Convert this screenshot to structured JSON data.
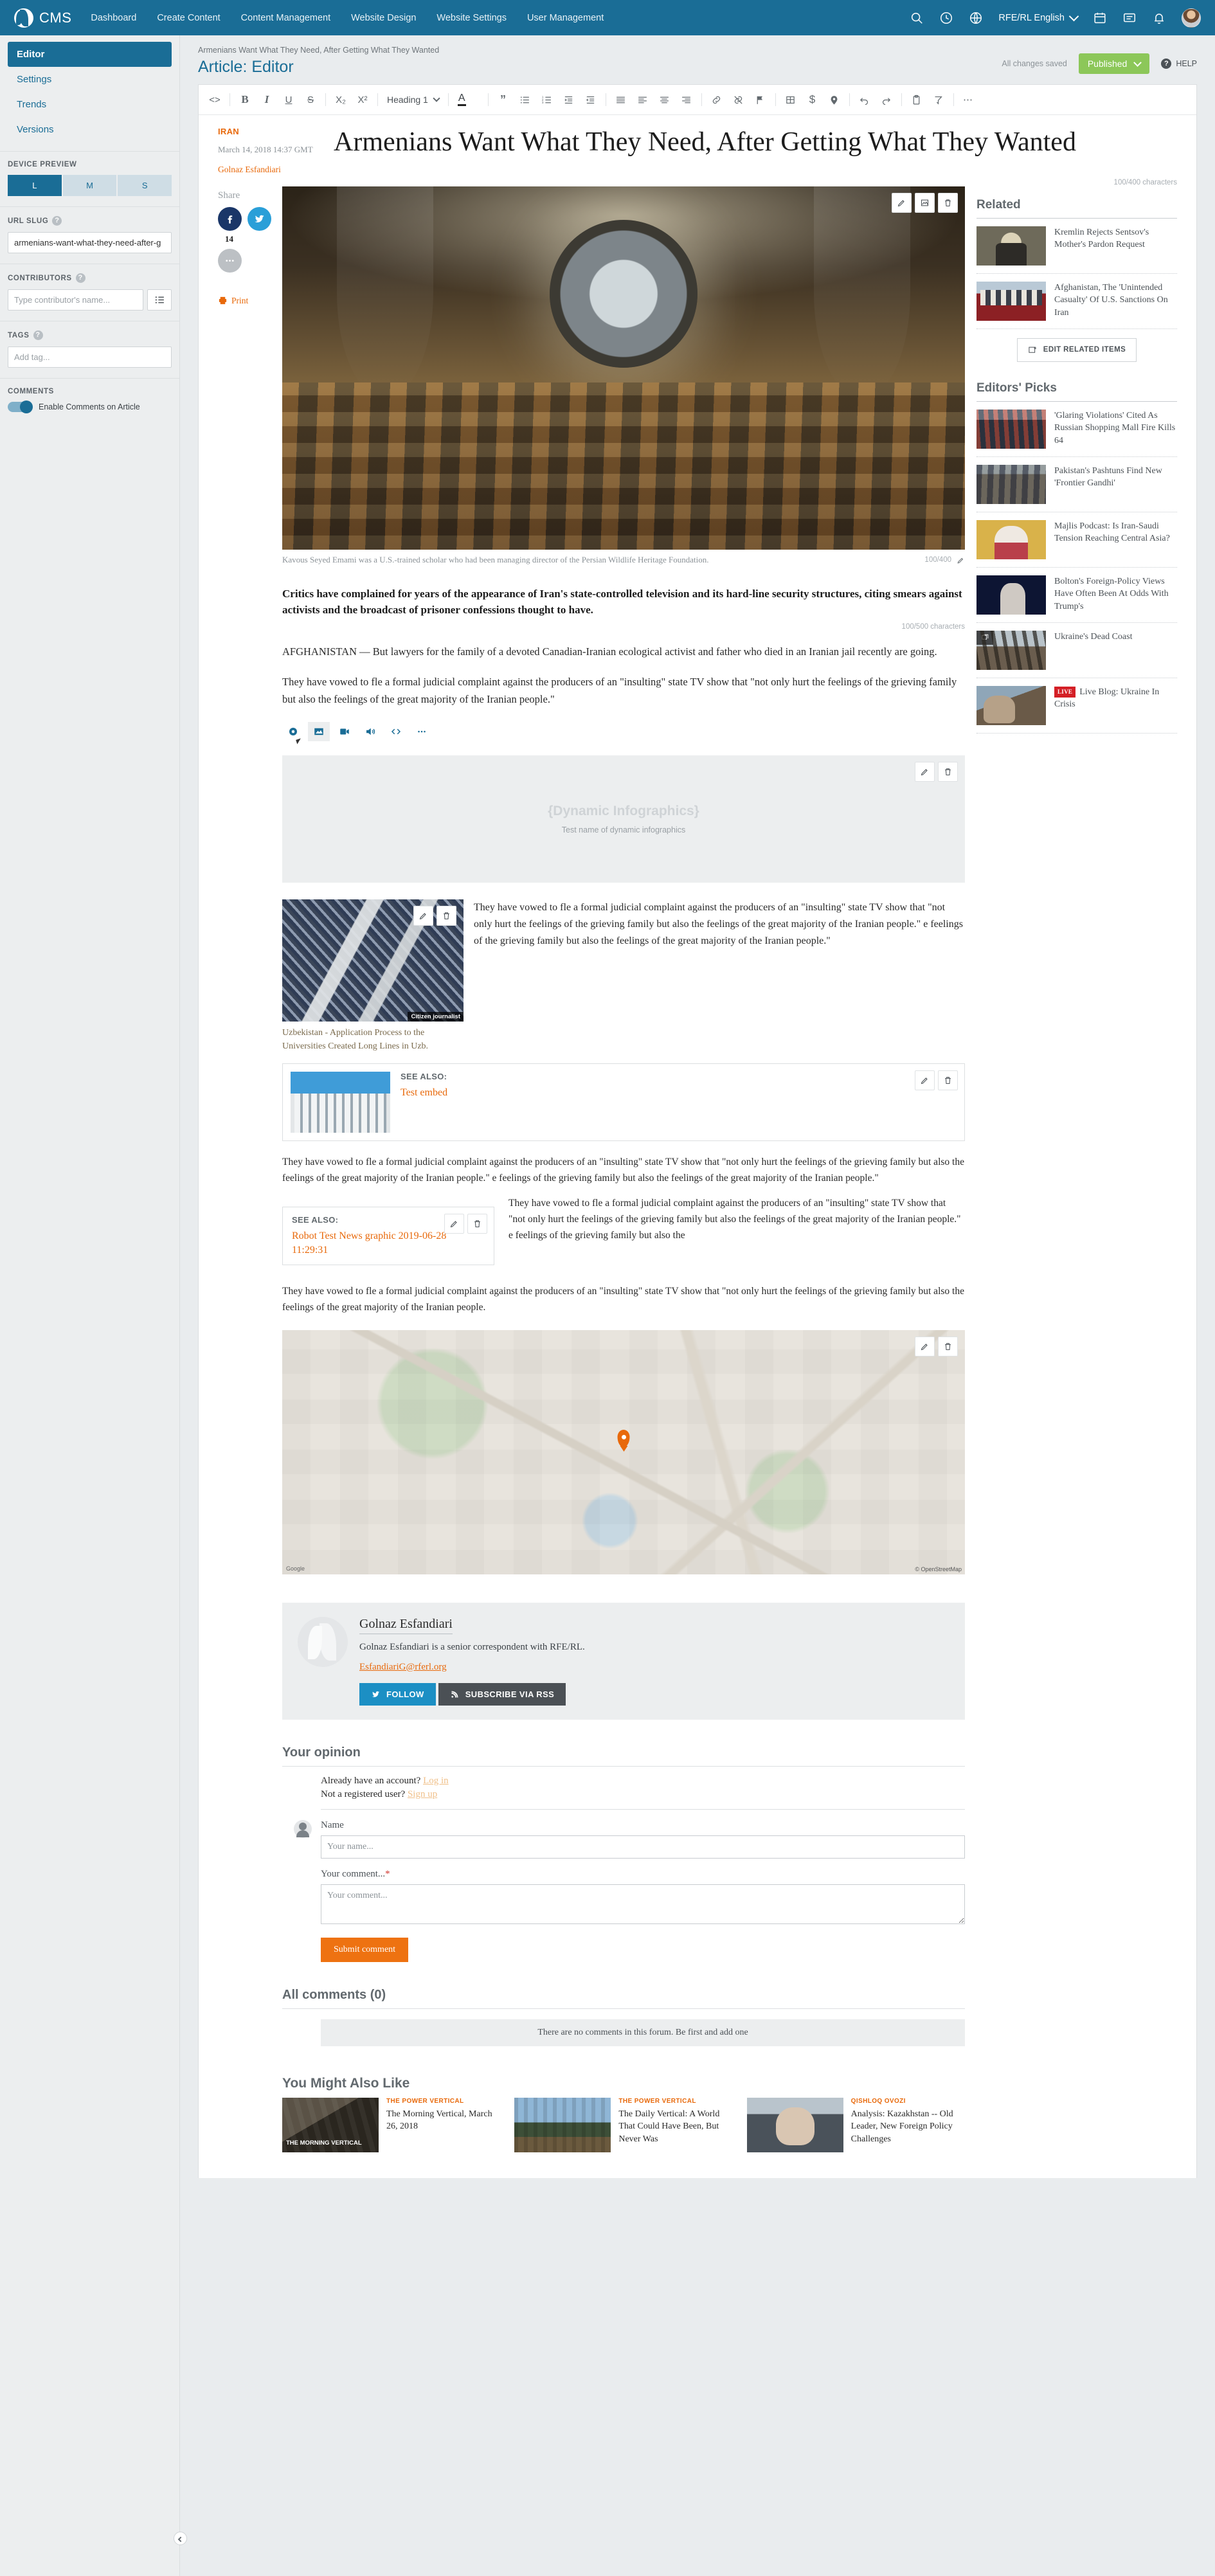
{
  "topnav": {
    "brand": "CMS",
    "items": [
      "Dashboard",
      "Create Content",
      "Content Management",
      "Website Design",
      "Website Settings",
      "User Management"
    ],
    "language": "RFE/RL English",
    "icons": [
      "search-icon",
      "clock-icon",
      "globe-icon",
      "calendar-icon",
      "message-icon",
      "bell-icon",
      "avatar"
    ]
  },
  "sidebar": {
    "menu": [
      {
        "label": "Editor",
        "active": true
      },
      {
        "label": "Settings",
        "active": false
      },
      {
        "label": "Trends",
        "active": false
      },
      {
        "label": "Versions",
        "active": false
      }
    ],
    "device_preview": {
      "label": "DEVICE PREVIEW",
      "options": [
        "L",
        "M",
        "S"
      ],
      "selected": "L"
    },
    "url_slug": {
      "label": "URL SLUG",
      "value": "armenians-want-what-they-need-after-g"
    },
    "contributors": {
      "label": "CONTRIBUTORS",
      "placeholder": "Type contributor's name..."
    },
    "tags": {
      "label": "TAGS",
      "placeholder": "Add tag..."
    },
    "comments": {
      "label": "COMMENTS",
      "toggle_label": "Enable Comments on Article",
      "enabled": true
    }
  },
  "header": {
    "breadcrumb": "Armenians Want What They Need, After Getting What They Wanted",
    "title": "Article: Editor",
    "saved_status": "All changes saved",
    "publish_state": "Published",
    "help": "HELP"
  },
  "toolbar": {
    "heading_select": "Heading 1",
    "buttons": [
      "source-code",
      "bold",
      "italic",
      "underline",
      "strikethrough",
      "subscript",
      "superscript",
      "heading-select",
      "text-color",
      "blockquote",
      "bullet-list",
      "numbered-list",
      "indent",
      "outdent",
      "align-justify",
      "align-left",
      "align-center",
      "align-right",
      "link",
      "unlink",
      "flag",
      "table",
      "currency",
      "location-pin",
      "undo",
      "redo",
      "paste",
      "clear-format",
      "more"
    ]
  },
  "article": {
    "kicker": "IRAN",
    "date": "March 14, 2018 14:37 GMT",
    "author": "Golnaz Esfandiari",
    "headline": "Armenians Want What They Need, After Getting What They Wanted",
    "headline_count": "100/400 characters",
    "share_label": "Share",
    "fb_count": "14",
    "print_label": "Print",
    "hero_caption": "Kavous Seyed Emami was a U.S.-trained scholar who had been managing director of the Persian Wildlife Heritage Foundation.",
    "hero_caption_count": "100/400",
    "lead_paragraph": "Critics have complained for years of the appearance of Iran's state-controlled television and its hard-line security structures, citing smears against activists and the broadcast of prisoner confessions thought to have.",
    "lead_count": "100/500 characters",
    "paragraph_2": "AFGHANISTAN — But lawyers for the family of a devoted Canadian-Iranian ecological activist and father who died in an Iranian jail recently are going.",
    "paragraph_3": "They have vowed to fle a formal judicial complaint against the producers of an \"insulting\" state TV show that \"not only hurt the feelings of the grieving family but also the feelings of the great majority of the Iranian people.\"",
    "paragraph_4": "They have vowed to fle a formal judicial complaint against the producers of an \"insulting\" state TV show that \"not only hurt the feelings of the grieving family but also the feelings of the great majority of the Iranian people.\" e feelings of the grieving family but also the feelings of the great majority of the Iranian people.\"",
    "paragraph_5": "They have vowed to fle a formal judicial complaint against the producers of an \"insulting\" state TV show that \"not only hurt the feelings of the grieving family but also the feelings of the great majority of the Iranian people.\" e feelings of the grieving family but also the feelings of the great majority of the Iranian people.\"",
    "paragraph_6": "They have vowed to fle a formal judicial complaint against the producers of an \"insulting\" state TV show that \"not only hurt the feelings of the grieving family but also the feelings of the great majority of the Iranian people.\" e feelings of the grieving family but also the",
    "paragraph_7": "They have vowed to fle a formal judicial complaint against the producers of an \"insulting\" state TV show that \"not only hurt the feelings of the grieving family but also the feelings of the great majority of the Iranian people.",
    "infographic": {
      "title": "{Dynamic Infographics}",
      "subtitle": "Test name of dynamic infographics"
    },
    "inline_image": {
      "credit": "Citizen journalist",
      "caption": "Uzbekistan - Application Process to the Universities Created Long Lines in Uzb."
    },
    "see_also_1": {
      "label": "SEE ALSO:",
      "title": "Test embed"
    },
    "see_also_2": {
      "label": "SEE ALSO:",
      "title": "Robot Test News graphic 2019-06-28 11:29:31"
    },
    "map": {
      "attribution": "© OpenStreetMap",
      "logo": "Google"
    }
  },
  "insert_bar": {
    "buttons": [
      "insert-image",
      "insert-video",
      "insert-audio",
      "insert-embed-code",
      "insert-more"
    ]
  },
  "author_box": {
    "name": "Golnaz Esfandiari",
    "bio": "Golnaz Esfandiari is a senior correspondent with RFE/RL.",
    "email": "EsfandiariG@rferl.org",
    "follow_label": "FOLLOW",
    "rss_label": "SUBSCRIBE VIA RSS"
  },
  "opinion": {
    "heading": "Your opinion",
    "account_text": "Already have an account?",
    "login_link": "Log in",
    "register_text": "Not a registered user?",
    "signup_link": "Sign up",
    "name_label": "Name",
    "name_placeholder": "Your name...",
    "comment_label": "Your comment...",
    "comment_placeholder": "Your comment...",
    "submit_label": "Submit comment",
    "all_comments_heading": "All comments (0)",
    "empty_message": "There are no comments in this forum. Be first and add one"
  },
  "related": {
    "heading": "Related",
    "items": [
      {
        "title": "Kremlin Rejects Sentsov's Mother's Pardon Request"
      },
      {
        "title": "Afghanistan, The 'Unintended Casualty' Of U.S. Sanctions On Iran"
      }
    ],
    "edit_button": "EDIT RELATED ITEMS"
  },
  "editors_picks": {
    "heading": "Editors' Picks",
    "items": [
      {
        "title": "'Glaring Violations' Cited As Russian Shopping Mall Fire Kills 64",
        "badge": ""
      },
      {
        "title": "Pakistan's Pashtuns Find New 'Frontier Gandhi'",
        "badge": ""
      },
      {
        "title": "Majlis Podcast: Is Iran-Saudi Tension Reaching Central Asia?",
        "badge": ""
      },
      {
        "title": "Bolton's Foreign-Policy Views Have Often Been At Odds With Trump's",
        "badge": ""
      },
      {
        "title": "Ukraine's Dead Coast",
        "badge": ""
      },
      {
        "title": "Live Blog: Ukraine In Crisis",
        "badge": "LIVE"
      }
    ]
  },
  "you_might_also_like": {
    "heading": "You Might Also Like",
    "items": [
      {
        "kicker": "THE POWER VERTICAL",
        "title": "The Morning Vertical, March 26, 2018",
        "overlay": "THE MORNING VERTICAL"
      },
      {
        "kicker": "THE POWER VERTICAL",
        "title": "The Daily Vertical: A World That Could Have Been, But Never Was",
        "overlay": ""
      },
      {
        "kicker": "QISHLOQ OVOZI",
        "title": "Analysis: Kazakhstan -- Old Leader, New Foreign Policy Challenges",
        "overlay": ""
      }
    ]
  },
  "colors": {
    "brand_blue": "#1a6d96",
    "publish_green": "#8cc759",
    "accent_orange": "#e8690b",
    "submit_orange": "#ee7211",
    "live_red": "#d41f26"
  }
}
